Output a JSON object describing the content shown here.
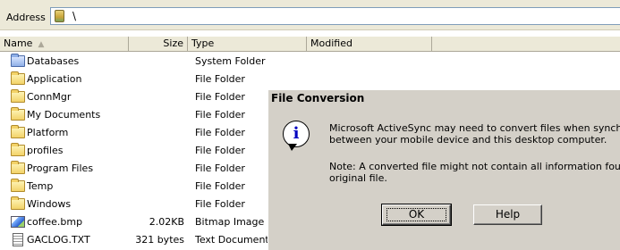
{
  "address_bar": {
    "label": "Address",
    "path": "\\"
  },
  "columns": {
    "name": "Name",
    "size": "Size",
    "type": "Type",
    "modified": "Modified"
  },
  "files": [
    {
      "name": "Databases",
      "size": "",
      "type": "System Folder",
      "icon": "system-folder-icon"
    },
    {
      "name": "Application",
      "size": "",
      "type": "File Folder",
      "icon": "folder-icon"
    },
    {
      "name": "ConnMgr",
      "size": "",
      "type": "File Folder",
      "icon": "folder-icon"
    },
    {
      "name": "My Documents",
      "size": "",
      "type": "File Folder",
      "icon": "folder-icon"
    },
    {
      "name": "Platform",
      "size": "",
      "type": "File Folder",
      "icon": "folder-icon"
    },
    {
      "name": "profiles",
      "size": "",
      "type": "File Folder",
      "icon": "folder-icon"
    },
    {
      "name": "Program Files",
      "size": "",
      "type": "File Folder",
      "icon": "folder-icon"
    },
    {
      "name": "Temp",
      "size": "",
      "type": "File Folder",
      "icon": "folder-icon"
    },
    {
      "name": "Windows",
      "size": "",
      "type": "File Folder",
      "icon": "folder-icon"
    },
    {
      "name": "coffee.bmp",
      "size": "2.02KB",
      "type": "Bitmap Image",
      "icon": "bitmap-file-icon"
    },
    {
      "name": "GACLOG.TXT",
      "size": "321 bytes",
      "type": "Text Document",
      "icon": "text-file-icon"
    }
  ],
  "dialog": {
    "title": "File Conversion",
    "icon": "info-icon",
    "message_line1": "Microsoft ActiveSync may need to convert files when synchro",
    "message_line2": "between your mobile device and this desktop computer.",
    "note_line1": "Note: A converted file might not contain all information found i",
    "note_line2": "original file.",
    "ok_label": "OK",
    "help_label": "Help"
  }
}
